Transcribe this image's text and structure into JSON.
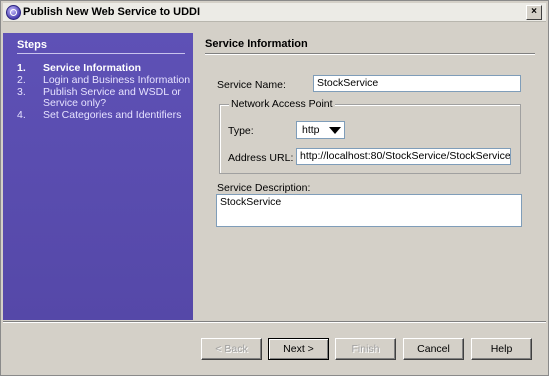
{
  "window": {
    "title": "Publish New Web Service to UDDI",
    "close_glyph": "×"
  },
  "steps": {
    "heading": "Steps",
    "items": [
      {
        "num": "1.",
        "label": "Service Information",
        "active": true
      },
      {
        "num": "2.",
        "label": "Login and Business Information",
        "active": false
      },
      {
        "num": "3.",
        "label": "Publish Service and WSDL or Service only?",
        "active": false
      },
      {
        "num": "4.",
        "label": "Set Categories and Identifiers",
        "active": false
      }
    ]
  },
  "content": {
    "heading": "Service Information",
    "service_name_label": "Service Name:",
    "service_name_value": "StockService",
    "network_group_title": "Network Access Point",
    "type_label": "Type:",
    "type_value": "http",
    "address_label": "Address URL:",
    "address_value": "http://localhost:80/StockService/StockService",
    "description_label": "Service Description:",
    "description_value": "StockService"
  },
  "buttons": {
    "back": "< Back",
    "next": "Next >",
    "finish": "Finish",
    "cancel": "Cancel",
    "help": "Help"
  },
  "icons": {
    "app": "uddi-globe-icon",
    "close": "close-icon",
    "dropdown": "chevron-down-icon"
  },
  "colors": {
    "steps_panel": "#5b4fb0",
    "dialog_bg": "#d4d0c8"
  }
}
